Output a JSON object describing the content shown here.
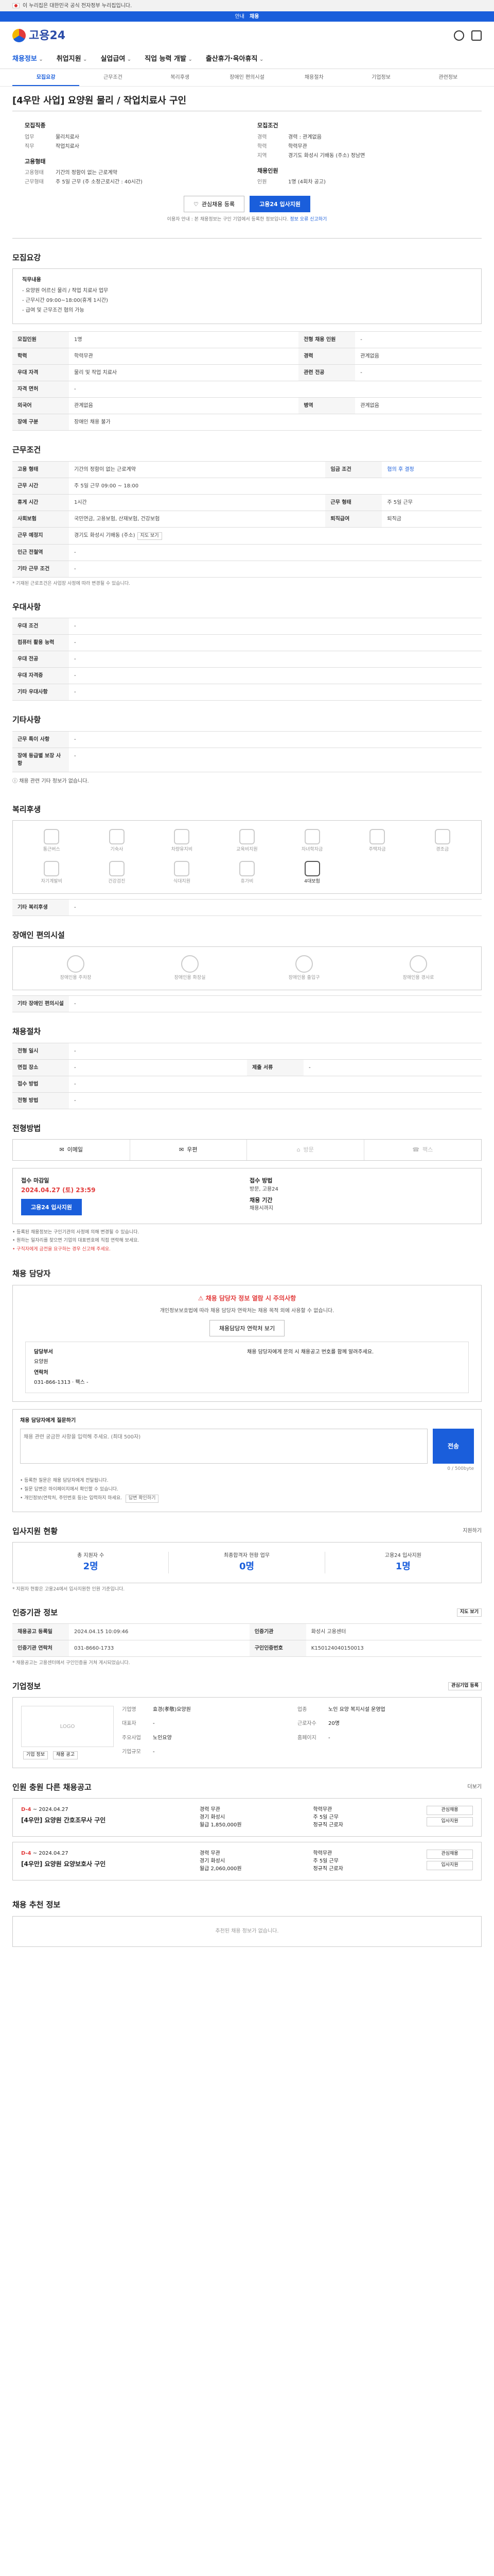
{
  "gov": {
    "banner": "이 누리집은 대한민국 공식 전자정부 누리집입니다."
  },
  "strip": {
    "label": "안내",
    "value": "채용"
  },
  "logo": {
    "text": "고용24"
  },
  "gnb": [
    "채용정보",
    "취업지원",
    "실업급여",
    "직업 능력 개발",
    "출산휴가·육아휴직"
  ],
  "subtabs": [
    "모집요강",
    "근무조건",
    "복리후생",
    "장애인 편의시설",
    "채용절차",
    "기업정보",
    "관련정보"
  ],
  "job": {
    "title": "[4우만 사업] 요양원 물리 / 작업치료사 구인",
    "left_header": "모집직종",
    "right_header": "모집조건",
    "left": [
      {
        "k": "업무",
        "v": "물리치료사"
      },
      {
        "k": "직무",
        "v": "작업치료사"
      }
    ],
    "right": [
      {
        "k": "경력",
        "v": "경력 : 관계없음"
      },
      {
        "k": "학력",
        "v": "학력무관"
      },
      {
        "k": "지역",
        "v": "경기도 화성시 기배동 (주소) 정남면"
      }
    ],
    "left2_header": "고용형태",
    "left2": [
      {
        "k": "고용형태",
        "v": "기간의 정함이 없는 근로계약"
      },
      {
        "k": "근무형태",
        "v": "주 5일 근무 (주 소정근로시간 : 40시간)"
      }
    ],
    "right2_header": "채용인원",
    "right2": [
      {
        "k": "인원",
        "v": "1명 (4회차 공고)"
      }
    ]
  },
  "cta": {
    "fav": "관심채용 등록",
    "apply": "고용24 입사지원"
  },
  "notice": {
    "text": "이용자 안내 : 본 채용정보는 구인 기업에서 등록한 정보입니다.",
    "link": "정보 오류 신고하기"
  },
  "sections": {
    "recruit": "모집요강",
    "work": "근무조건",
    "extra": "우대사항",
    "other": "기타사항",
    "welfare": "복리후생",
    "disability": "장애인 편의시설",
    "process": "채용절차",
    "method": "전형방법",
    "contact": "채용 담당자",
    "inquiry": "채용 담당자에게 질문하기",
    "stats": "입사지원 현황",
    "reg": "인증기관 정보",
    "company": "기업정보",
    "related": "인원 충원 다른 채용공고",
    "recommend": "채용 추천 정보"
  },
  "recruit": {
    "desc_label": "직무내용",
    "desc_lines": [
      "- 요양원 어르신 물리 / 작업 치료사 업무",
      "- 근무시간 09:00~18:00(휴게 1시간)",
      "- 급여 및 근무조건 협의 가능"
    ],
    "rows": [
      {
        "k": "모집인원",
        "v": "1명",
        "k2": "전형 채용 인원",
        "v2": "-"
      },
      {
        "k": "학력",
        "v": "학력무관",
        "k2": "경력",
        "v2": "관계없음"
      },
      {
        "k": "우대 자격",
        "v": "물리 및 작업 치료사",
        "k2": "관련 전공",
        "v2": "-"
      },
      {
        "k": "자격 면허",
        "v": "-",
        "k2": "",
        "v2": ""
      },
      {
        "k": "외국어",
        "v": "관계없음",
        "k2": "병역",
        "v2": "관계없음"
      },
      {
        "k": "장애 구분",
        "v": "장애인 채용 불가",
        "k2": "",
        "v2": ""
      }
    ]
  },
  "work": {
    "rows": [
      {
        "k": "고용 형태",
        "v": "기간의 정함이 없는 근로계약",
        "k2": "임금 조건",
        "v2": "협의 후 결정"
      },
      {
        "k": "근무 시간",
        "v": "주 5일 근무 09:00 ~ 18:00",
        "k2": "",
        "v2": ""
      },
      {
        "k": "휴게 시간",
        "v": "1시간",
        "k2": "근무 형태",
        "v2": "주 5일 근무"
      },
      {
        "k": "사회보험",
        "v": "국민연금, 고용보험, 산재보험, 건강보험",
        "k2": "퇴직급여",
        "v2": "퇴직금"
      },
      {
        "k": "근무 예정지",
        "v": "경기도 화성시 기배동 (주소)",
        "k2": "",
        "v2": ""
      },
      {
        "k": "인근 전철역",
        "v": "-",
        "k2": "",
        "v2": ""
      },
      {
        "k": "기타 근무 조건",
        "v": "-",
        "k2": "",
        "v2": ""
      }
    ],
    "map_btn": "지도 보기",
    "note": "* 기재된 근로조건은 사업장 사정에 따라 변경될 수 있습니다."
  },
  "extra": {
    "rows": [
      {
        "k": "우대 조건",
        "v": "-"
      },
      {
        "k": "컴퓨터 활용 능력",
        "v": "-"
      },
      {
        "k": "우대 전공",
        "v": "-"
      },
      {
        "k": "우대 자격증",
        "v": "-"
      },
      {
        "k": "기타 우대사항",
        "v": "-"
      }
    ]
  },
  "other": {
    "rows": [
      {
        "k": "근무 특이 사항",
        "v": "-"
      },
      {
        "k": "장애 등급별 보장 사항",
        "v": "-"
      }
    ],
    "tip": "채용 관련 기타 정보가 없습니다."
  },
  "welfare": {
    "items": [
      {
        "name": "통근버스",
        "on": false
      },
      {
        "name": "기숙사",
        "on": false
      },
      {
        "name": "차량유지비",
        "on": false
      },
      {
        "name": "교육비지원",
        "on": false
      },
      {
        "name": "자녀학자금",
        "on": false
      },
      {
        "name": "주택자금",
        "on": false
      },
      {
        "name": "경조금",
        "on": false
      },
      {
        "name": "자기계발비",
        "on": false
      },
      {
        "name": "건강검진",
        "on": false
      },
      {
        "name": "식대지원",
        "on": false
      },
      {
        "name": "휴가비",
        "on": false
      },
      {
        "name": "4대보험",
        "on": true
      }
    ],
    "extra_label": "기타 복리후생",
    "extra_val": "-"
  },
  "disability": {
    "items": [
      "장애인용 주차장",
      "장애인용 화장실",
      "장애인용 출입구",
      "장애인용 경사로"
    ],
    "extra_label": "기타 장애인 편의시설",
    "extra_val": "-"
  },
  "process": {
    "rows": [
      {
        "k": "전형 일시",
        "v": "-",
        "k2": "",
        "v2": ""
      },
      {
        "k": "면접 장소",
        "v": "-",
        "k2": "제출 서류",
        "v2": "-"
      },
      {
        "k": "접수 방법",
        "v": "-",
        "k2": "",
        "v2": ""
      },
      {
        "k": "전형 방법",
        "v": "-",
        "k2": "",
        "v2": ""
      }
    ]
  },
  "method": {
    "items": [
      {
        "name": "이메일",
        "on": true
      },
      {
        "name": "우편",
        "on": true
      },
      {
        "name": "방문",
        "on": false
      },
      {
        "name": "팩스",
        "on": false
      }
    ]
  },
  "deadline": {
    "h1": "접수 마감일",
    "date": "2024.04.27 (토) 23:59",
    "h2": "접수 방법",
    "method": "방문, 고용24",
    "h3": "채용 기간",
    "period": "채용시까지",
    "apply_btn": "고용24 입사지원",
    "bullets": [
      "등록된 채용정보는 구인기관의 사정에 의해 변경될 수 있습니다.",
      "원하는 일자리를 찾으면 기업의 대표번호에 직접 연락해 보세요."
    ],
    "warn": "구직자에게 금전을 요구하는 경우 신고해 주세요."
  },
  "contact": {
    "alert": "채용 담당자 정보 열람 시 주의사항",
    "text": "개인정보보호법에 따라 채용 담당자 연락처는 채용 목적 외에 사용할 수 없습니다.",
    "btn": "채용담당자 연락처 보기",
    "dept_label": "담당부서",
    "dept": "요양원",
    "phone_label": "연락처",
    "phone": "031-866-1313",
    "fax_label": "팩스",
    "fax": "-",
    "detail": "채용 담당자에게 문의 시 채용공고 번호를 함께 알려주세요."
  },
  "inquiry": {
    "lead": "채용 담당자에게 질문하기",
    "placeholder": "채용 관련 궁금한 사항을 입력해 주세요. (최대 500자)",
    "send": "전송",
    "counter": "0 / 500byte",
    "guide": [
      "등록한 질문은 채용 담당자에게 전달됩니다.",
      "질문 답변은 마이페이지에서 확인할 수 있습니다.",
      "개인정보(연락처, 주민번호 등)는 입력하지 마세요."
    ],
    "guide_btn": "답변 확인하기"
  },
  "stats": {
    "right": "지원하기",
    "items": [
      {
        "label": "총 지원자 수",
        "value": "2명"
      },
      {
        "label": "최종합격자 현황 업무",
        "value": "0명"
      },
      {
        "label": "고용24 입사지원",
        "value": "1명"
      }
    ],
    "note": "* 지원자 현황은 고용24에서 입사지원한 인원 기준입니다."
  },
  "reg": {
    "btn": "지도 보기",
    "rows": [
      {
        "k": "채용공고 등록일",
        "v": "2024.04.15 10:09:46",
        "k2": "인증기관",
        "v2": "화성시 고용센터"
      },
      {
        "k": "인증기관 연락처",
        "v": "031-8660-1733",
        "k2": "구인인증번호",
        "v2": "K150124040150013"
      }
    ],
    "note": "* 채용공고는 고용센터에서 구인인증을 거쳐 게시되었습니다."
  },
  "company": {
    "logo": "LOGO",
    "fav_btn": "관심기업 등록",
    "rows": [
      {
        "k": "기업명",
        "v": "효경(孝敬)요양원",
        "k2": "업종",
        "v2": "노인 요양 복지시설 운영업"
      },
      {
        "k": "대표자",
        "v": "-",
        "k2": "근로자수",
        "v2": "20명"
      },
      {
        "k": "주요사업",
        "v": "노인요양",
        "k2": "홈페이지",
        "v2": "-"
      },
      {
        "k": "기업규모",
        "v": "-",
        "k2": "",
        "v2": ""
      }
    ],
    "b1": "기업 정보",
    "b2": "채용 공고"
  },
  "related": {
    "more": "더보기",
    "cards": [
      {
        "dday": "D-4",
        "date": "~ 2024.04.27",
        "name": "[4우만] 요양원 간호조무사 구인",
        "c1": "경력 무관",
        "c2": "학력무관",
        "c3": "경기 화성시",
        "c4": "주 5일 근무",
        "c5": "월급 1,850,000원",
        "c6": "정규직 근로자"
      },
      {
        "dday": "D-4",
        "date": "~ 2024.04.27",
        "name": "[4우만] 요양원 요양보호사 구인",
        "c1": "경력 무관",
        "c2": "학력무관",
        "c3": "경기 화성시",
        "c4": "주 5일 근무",
        "c5": "월급 2,060,000원",
        "c6": "정규직 근로자"
      }
    ],
    "btn_a": "관심채용",
    "btn_b": "입사지원"
  },
  "recommend": {
    "empty": "추천된 채용 정보가 없습니다."
  }
}
